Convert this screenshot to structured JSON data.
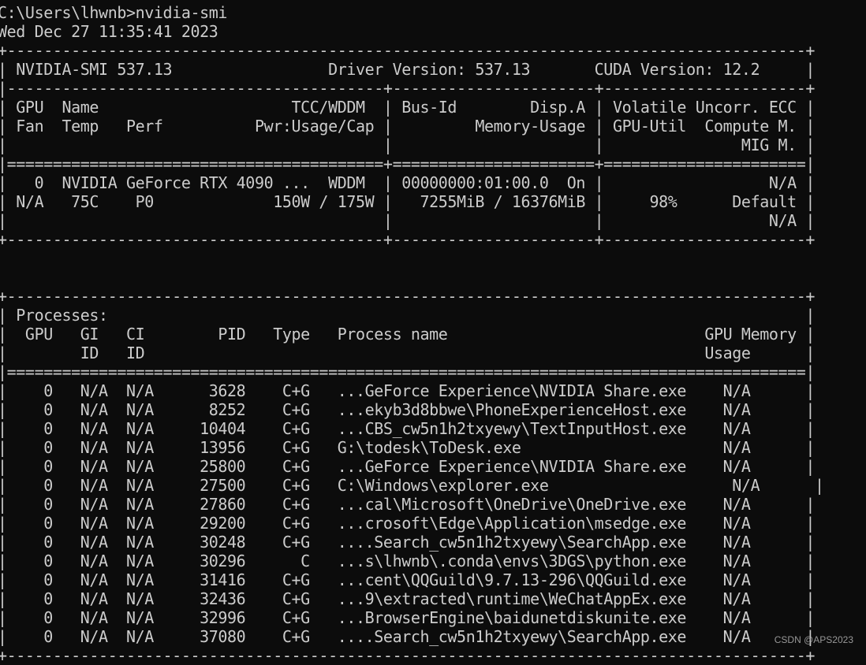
{
  "terminal": {
    "prompt": "C:\\Users\\lhwnb>nvidia-smi",
    "timestamp": "Wed Dec 27 11:35:41 2023",
    "border_top": "+---------------------------------------------------------------------------------------+",
    "header_line": "| NVIDIA-SMI 537.13                 Driver Version: 537.13       CUDA Version: 12.2     |",
    "header_sep": "|-----------------------------------------+----------------------+----------------------+",
    "gpu_col_h1": "| GPU  Name                     TCC/WDDM  | Bus-Id        Disp.A | Volatile Uncorr. ECC |",
    "gpu_col_h2": "| Fan  Temp   Perf          Pwr:Usage/Cap |         Memory-Usage | GPU-Util  Compute M. |",
    "gpu_col_h3": "|                                         |                      |               MIG M. |",
    "gpu_col_sep": "|=========================================+======================+======================|",
    "gpu_row1": "|   0  NVIDIA GeForce RTX 4090 ...  WDDM  | 00000000:01:00.0  On |                  N/A |",
    "gpu_row2": "| N/A   75C    P0             150W / 175W |   7255MiB / 16376MiB |     98%      Default |",
    "gpu_row3": "|                                         |                      |                  N/A |",
    "gpu_border": "+-----------------------------------------+----------------------+----------------------+",
    "blank": "",
    "proc_border_top": "+---------------------------------------------------------------------------------------+",
    "proc_title": "| Processes:                                                                            |",
    "proc_h1": "|  GPU   GI   CI        PID   Type   Process name                            GPU Memory |",
    "proc_h2": "|        ID   ID                                                             Usage      |",
    "proc_sep": "|=======================================================================================|",
    "proc_border_bottom": "+---------------------------------------------------------------------------------------+"
  },
  "gpu": {
    "index": "0",
    "name": "NVIDIA GeForce RTX 4090 ...",
    "mode": "WDDM",
    "bus_id": "00000000:01:00.0",
    "display_active": "On",
    "ecc": "N/A",
    "fan": "N/A",
    "temp": "75C",
    "perf": "P0",
    "power_usage": "150W",
    "power_cap": "175W",
    "memory_used": "7255MiB",
    "memory_total": "16376MiB",
    "gpu_util": "98%",
    "compute_mode": "Default",
    "mig_mode": "N/A",
    "driver_version": "537.13",
    "cuda_version": "12.2",
    "smi_version": "537.13"
  },
  "process_columns": [
    "GPU",
    "GI ID",
    "CI ID",
    "PID",
    "Type",
    "Process name",
    "GPU Memory Usage"
  ],
  "processes": [
    {
      "line": "|    0   N/A  N/A      3628    C+G   ...GeForce Experience\\NVIDIA Share.exe    N/A      |",
      "gpu": "0",
      "gi": "N/A",
      "ci": "N/A",
      "pid": "3628",
      "type": "C+G",
      "name": "...GeForce Experience\\NVIDIA Share.exe",
      "mem": "N/A"
    },
    {
      "line": "|    0   N/A  N/A      8252    C+G   ...ekyb3d8bbwe\\PhoneExperienceHost.exe    N/A      |",
      "gpu": "0",
      "gi": "N/A",
      "ci": "N/A",
      "pid": "8252",
      "type": "C+G",
      "name": "...ekyb3d8bbwe\\PhoneExperienceHost.exe",
      "mem": "N/A"
    },
    {
      "line": "|    0   N/A  N/A     10404    C+G   ...CBS_cw5n1h2txyewy\\TextInputHost.exe    N/A      |",
      "gpu": "0",
      "gi": "N/A",
      "ci": "N/A",
      "pid": "10404",
      "type": "C+G",
      "name": "...CBS_cw5n1h2txyewy\\TextInputHost.exe",
      "mem": "N/A"
    },
    {
      "line": "|    0   N/A  N/A     13956    C+G   G:\\todesk\\ToDesk.exe                      N/A      |",
      "gpu": "0",
      "gi": "N/A",
      "ci": "N/A",
      "pid": "13956",
      "type": "C+G",
      "name": "G:\\todesk\\ToDesk.exe",
      "mem": "N/A"
    },
    {
      "line": "|    0   N/A  N/A     25800    C+G   ...GeForce Experience\\NVIDIA Share.exe    N/A      |",
      "gpu": "0",
      "gi": "N/A",
      "ci": "N/A",
      "pid": "25800",
      "type": "C+G",
      "name": "...GeForce Experience\\NVIDIA Share.exe",
      "mem": "N/A"
    },
    {
      "line": "|    0   N/A  N/A     27500    C+G   C:\\Windows\\explorer.exe                    N/A      |",
      "gpu": "0",
      "gi": "N/A",
      "ci": "N/A",
      "pid": "27500",
      "type": "C+G",
      "name": "C:\\Windows\\explorer.exe",
      "mem": "N/A"
    },
    {
      "line": "|    0   N/A  N/A     27860    C+G   ...cal\\Microsoft\\OneDrive\\OneDrive.exe    N/A      |",
      "gpu": "0",
      "gi": "N/A",
      "ci": "N/A",
      "pid": "27860",
      "type": "C+G",
      "name": "...cal\\Microsoft\\OneDrive\\OneDrive.exe",
      "mem": "N/A"
    },
    {
      "line": "|    0   N/A  N/A     29200    C+G   ...crosoft\\Edge\\Application\\msedge.exe    N/A      |",
      "gpu": "0",
      "gi": "N/A",
      "ci": "N/A",
      "pid": "29200",
      "type": "C+G",
      "name": "...crosoft\\Edge\\Application\\msedge.exe",
      "mem": "N/A"
    },
    {
      "line": "|    0   N/A  N/A     30248    C+G   ....Search_cw5n1h2txyewy\\SearchApp.exe    N/A      |",
      "gpu": "0",
      "gi": "N/A",
      "ci": "N/A",
      "pid": "30248",
      "type": "C+G",
      "name": "....Search_cw5n1h2txyewy\\SearchApp.exe",
      "mem": "N/A"
    },
    {
      "line": "|    0   N/A  N/A     30296      C   ...s\\lhwnb\\.conda\\envs\\3DGS\\python.exe    N/A      |",
      "gpu": "0",
      "gi": "N/A",
      "ci": "N/A",
      "pid": "30296",
      "type": "C",
      "name": "...s\\lhwnb\\.conda\\envs\\3DGS\\python.exe",
      "mem": "N/A"
    },
    {
      "line": "|    0   N/A  N/A     31416    C+G   ...cent\\QQGuild\\9.7.13-296\\QQGuild.exe    N/A      |",
      "gpu": "0",
      "gi": "N/A",
      "ci": "N/A",
      "pid": "31416",
      "type": "C+G",
      "name": "...cent\\QQGuild\\9.7.13-296\\QQGuild.exe",
      "mem": "N/A"
    },
    {
      "line": "|    0   N/A  N/A     32436    C+G   ...9\\extracted\\runtime\\WeChatAppEx.exe    N/A      |",
      "gpu": "0",
      "gi": "N/A",
      "ci": "N/A",
      "pid": "32436",
      "type": "C+G",
      "name": "...9\\extracted\\runtime\\WeChatAppEx.exe",
      "mem": "N/A"
    },
    {
      "line": "|    0   N/A  N/A     32996    C+G   ...BrowserEngine\\baidunetdiskunite.exe    N/A      |",
      "gpu": "0",
      "gi": "N/A",
      "ci": "N/A",
      "pid": "32996",
      "type": "C+G",
      "name": "...BrowserEngine\\baidunetdiskunite.exe",
      "mem": "N/A"
    },
    {
      "line": "|    0   N/A  N/A     37080    C+G   ....Search_cw5n1h2txyewy\\SearchApp.exe    N/A      |",
      "gpu": "0",
      "gi": "N/A",
      "ci": "N/A",
      "pid": "37080",
      "type": "C+G",
      "name": "....Search_cw5n1h2txyewy\\SearchApp.exe",
      "mem": "N/A"
    }
  ],
  "watermark": "CSDN @APS2023",
  "colors": {
    "background": "#0c0c0c",
    "text": "#cccccc"
  }
}
